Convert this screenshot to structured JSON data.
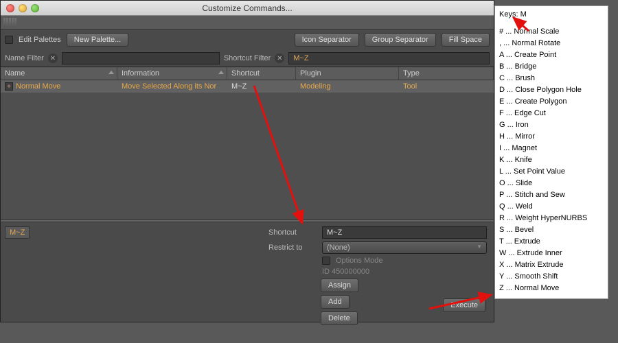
{
  "window": {
    "title": "Customize Commands..."
  },
  "row1": {
    "edit_palettes_label": "Edit Palettes",
    "new_palette_label": "New Palette...",
    "icon_separator": "Icon Separator",
    "group_separator": "Group Separator",
    "fill_space": "Fill Space"
  },
  "filters": {
    "name_label": "Name Filter",
    "name_value": "",
    "shortcut_label": "Shortcut Filter",
    "shortcut_value": "M~Z"
  },
  "table": {
    "headers": {
      "name": "Name",
      "info": "Information",
      "shortcut": "Shortcut",
      "plugin": "Plugin",
      "type": "Type"
    },
    "row": {
      "name": "Normal Move",
      "info": "Move Selected Along its Nor",
      "shortcut": "M~Z",
      "plugin": "Modeling",
      "type": "Tool"
    }
  },
  "detail": {
    "selected_name": "M~Z",
    "shortcut_label": "Shortcut",
    "shortcut_value": "M~Z",
    "restrict_label": "Restrict to",
    "restrict_value": "(None)",
    "options_mode": "Options Mode",
    "id_label": "ID 450000000",
    "assign": "Assign",
    "add": "Add",
    "delete": "Delete",
    "execute": "Execute"
  },
  "popup": {
    "header_prefix": "Keys: ",
    "header_key": "M",
    "items": [
      "# ... Normal Scale",
      ", ... Normal Rotate",
      "A ... Create Point",
      "B ... Bridge",
      "C ... Brush",
      "D ... Close Polygon Hole",
      "E ... Create Polygon",
      "F ... Edge Cut",
      "G ... Iron",
      "H ... Mirror",
      "I ... Magnet",
      "K ... Knife",
      "L ... Set Point Value",
      "O ... Slide",
      "P ... Stitch and Sew",
      "Q ... Weld",
      "R ... Weight HyperNURBS",
      "S ... Bevel",
      "T ... Extrude",
      "W ... Extrude Inner",
      "X ... Matrix Extrude",
      "Y ... Smooth Shift",
      "Z ... Normal Move"
    ]
  }
}
